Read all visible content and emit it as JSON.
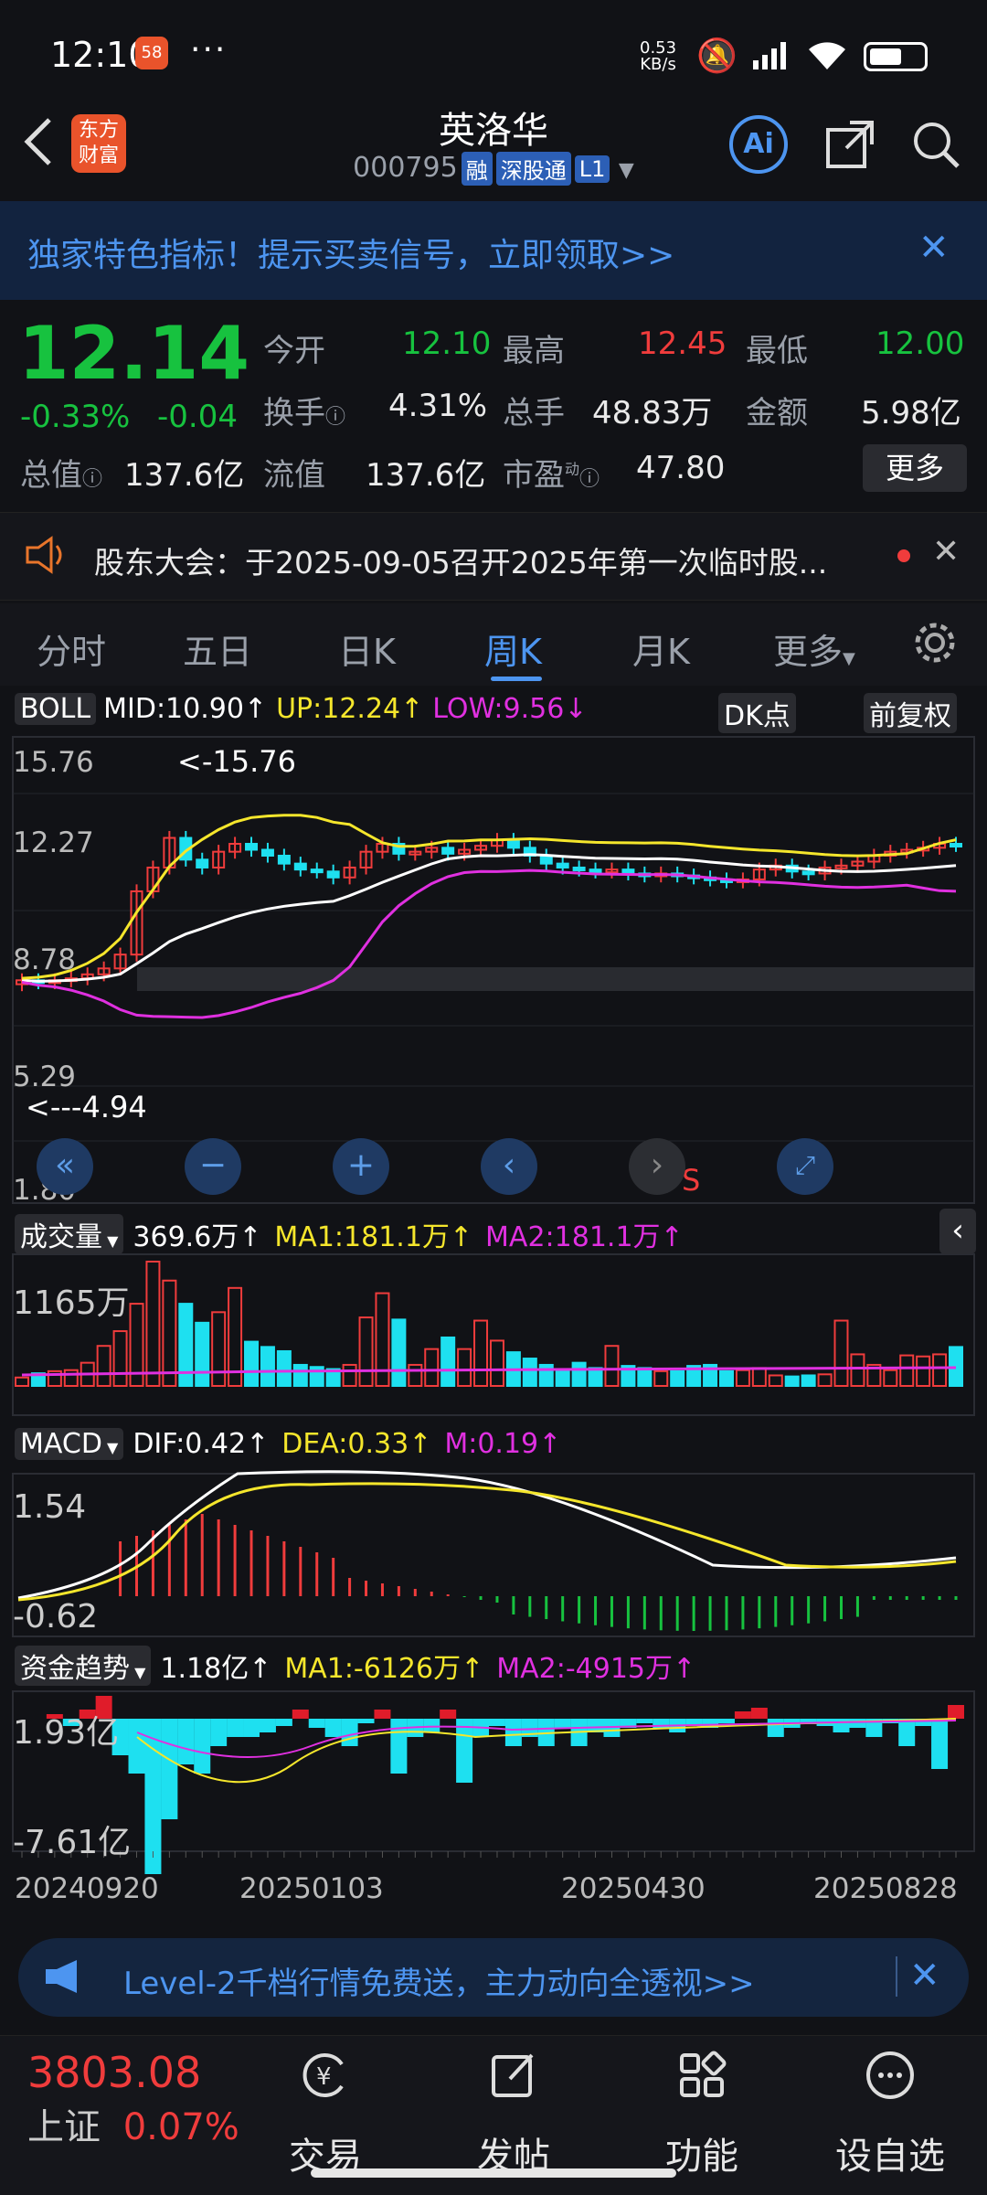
{
  "status_bar": {
    "time": "12:10",
    "dots": "···",
    "net_speed": "0.53",
    "net_unit": "KB/s",
    "app_badge": "58"
  },
  "header": {
    "stock_name": "英洛华",
    "stock_code": "000795",
    "tags": [
      "融",
      "深股通",
      "L1"
    ],
    "logo_line1": "东方",
    "logo_line2": "财富",
    "ai_label": "Ai"
  },
  "promo_banner": {
    "text": "独家特色指标！提示买卖信号，立即领取>>"
  },
  "quote": {
    "price": "12.14",
    "change_pct": "-0.33%",
    "change_amt": "-0.04",
    "open_label": "今开",
    "open": "12.10",
    "high_label": "最高",
    "high": "12.45",
    "low_label": "最低",
    "low": "12.00",
    "turnover_label": "换手",
    "turnover": "4.31%",
    "volume_label": "总手",
    "volume": "48.83万",
    "amount_label": "金额",
    "amount": "5.98亿",
    "total_mv_label": "总值",
    "total_mv": "137.6亿",
    "float_mv_label": "流值",
    "float_mv": "137.6亿",
    "pe_label": "市盈",
    "pe_sup": "动",
    "pe": "47.80",
    "more_button": "更多"
  },
  "notice": {
    "text": "股东大会：于2025-09-05召开2025年第一次临时股..."
  },
  "tabs": [
    {
      "label": "分时"
    },
    {
      "label": "五日"
    },
    {
      "label": "日K"
    },
    {
      "label": "周K"
    },
    {
      "label": "月K"
    },
    {
      "label": "更多"
    }
  ],
  "active_tab": "周K",
  "boll": {
    "indicator": "BOLL",
    "mid": "MID:10.90↑",
    "up": "UP:12.24↑",
    "low": "LOW:9.56↓",
    "dk_button": "DK点",
    "fq_button": "前复权",
    "y_labels": [
      "15.76",
      "12.27",
      "8.78",
      "5.29",
      "1.80"
    ],
    "max_note": "<-15.76",
    "min_note": "<---4.94",
    "signal": "S"
  },
  "volume_panel": {
    "indicator": "成交量",
    "vol": "369.6万↑",
    "ma1": "MA1:181.1万↑",
    "ma2": "MA2:181.1万↑",
    "y_label": "1165万"
  },
  "macd_panel": {
    "indicator": "MACD",
    "dif": "DIF:0.42↑",
    "dea": "DEA:0.33↑",
    "m": "M:0.19↑",
    "y_labels": [
      "1.54",
      "-0.62"
    ]
  },
  "fund_panel": {
    "indicator": "资金趋势",
    "val": "1.18亿↑",
    "ma1": "MA1:-6126万↑",
    "ma2": "MA2:-4915万↑",
    "y_labels": [
      "1.93亿",
      "-7.61亿"
    ]
  },
  "x_dates": [
    "20240920",
    "20250103",
    "20250430",
    "20250828"
  ],
  "level2_banner": {
    "text": "Level-2千档行情免费送，主力动向全透视>>"
  },
  "index_ticker": {
    "value": "3803.08",
    "name": "上证",
    "pct": "0.07%"
  },
  "bottom_nav": [
    {
      "label": "交易",
      "icon": "yen-icon"
    },
    {
      "label": "发帖",
      "icon": "edit-icon"
    },
    {
      "label": "功能",
      "icon": "grid-icon"
    },
    {
      "label": "设自选",
      "icon": "chat-icon"
    }
  ],
  "colors": {
    "up": "#f03c3c",
    "down": "#17c23f",
    "accent": "#4d95f0",
    "boll_up": "#f5e62c",
    "boll_low": "#e030e0",
    "cyan": "#1ee0f0"
  }
}
